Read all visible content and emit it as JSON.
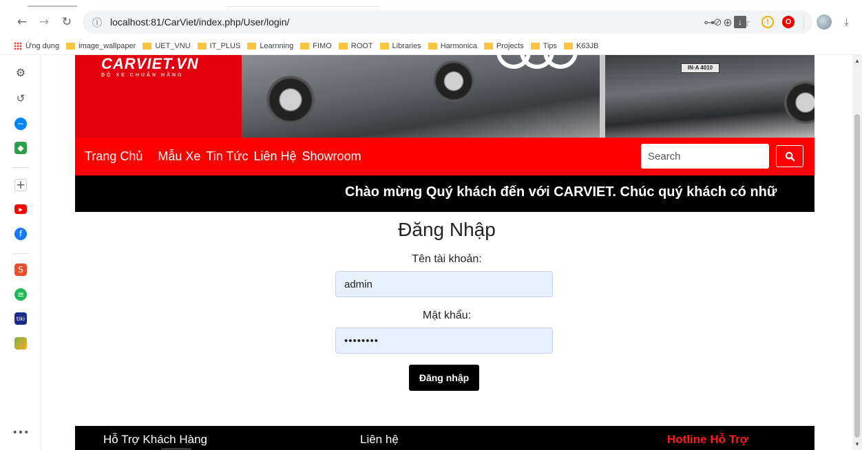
{
  "browser": {
    "url": "localhost:81/CarViet/index.php/User/login/",
    "bookmarks": [
      "Ứng dụng",
      "image_wallpaper",
      "UET_VNU",
      "IT_PLUS",
      "Learnning",
      "FIMO",
      "ROOT",
      "Libraries",
      "Harmonica",
      "Projects",
      "Tips",
      "K63JB"
    ],
    "sidebar_icons": [
      "gear-icon",
      "history-icon",
      "messenger-icon",
      "gamepad-icon",
      "add-icon",
      "youtube-icon",
      "facebook-icon",
      "shopee-icon",
      "spotify-icon",
      "tiki-icon",
      "game-icon",
      "more-icon"
    ]
  },
  "site": {
    "logo": "CARVIET.VN",
    "slogan": "ĐỘ XE CHUẨN HÃNG",
    "plate": "IN·A 4010",
    "nav": [
      "Trang Chủ",
      "Mẫu Xe",
      "Tin Tức",
      "Liên Hệ",
      "Showroom"
    ],
    "search_placeholder": "Search",
    "marquee": "Chào mừng Quý khách đến với CARVIET. Chúc quý khách có nhữ",
    "colors": {
      "brand_red": "#ff0000",
      "black": "#000000",
      "autofill": "#e8f0fe",
      "hotline": "#ff1a1a"
    }
  },
  "login": {
    "title": "Đăng Nhập",
    "username_label": "Tên tài khoản:",
    "username_value": "admin",
    "password_label": "Mật khẩu:",
    "password_value": "••••••••",
    "submit_label": "Đăng nhập"
  },
  "footer": {
    "col1": "Hỗ Trợ Khách Hàng",
    "col2": "Liên hệ",
    "col3": "Hotline Hỗ Trợ"
  }
}
